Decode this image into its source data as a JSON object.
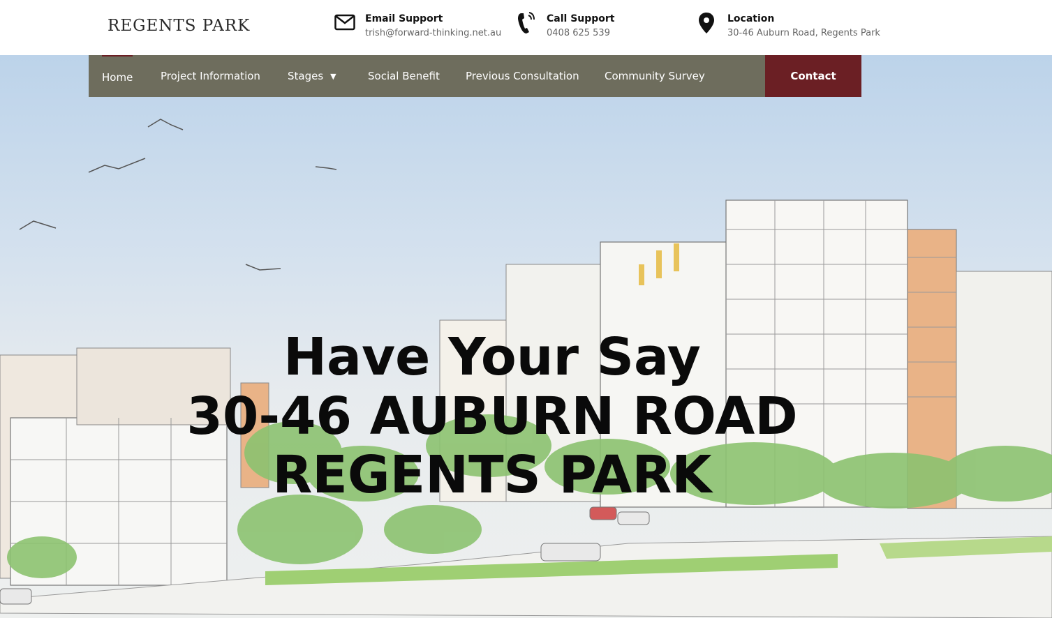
{
  "header": {
    "logo_text": "REGENTS PARK",
    "email": {
      "icon": "envelope-icon",
      "label": "Email Support",
      "value": "trish@forward-thinking.net.au"
    },
    "phone": {
      "icon": "phone-icon",
      "label": "Call Support",
      "value": "0408 625 539"
    },
    "location": {
      "icon": "map-pin-icon",
      "label": "Location",
      "value": "30-46 Auburn Road, Regents Park"
    }
  },
  "nav": {
    "items": [
      {
        "label": "Home"
      },
      {
        "label": "Project Information"
      },
      {
        "label": "Stages"
      },
      {
        "label": "Social Benefit"
      },
      {
        "label": "Previous Consultation"
      },
      {
        "label": "Community Survey"
      }
    ],
    "contact_label": "Contact"
  },
  "hero": {
    "line1": "Have Your Say",
    "line2": "30-46 AUBURN ROAD",
    "line3": "REGENTS PARK"
  },
  "colors": {
    "nav_bg": "#6e6d5d",
    "accent": "#6b1f24",
    "text": "#0a0a0a"
  }
}
